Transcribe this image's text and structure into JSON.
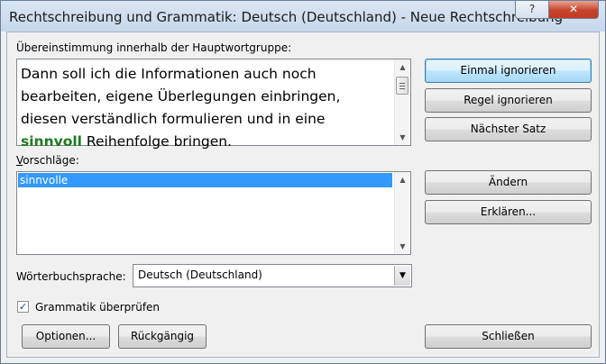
{
  "window": {
    "title": "Rechtschreibung und Grammatik: Deutsch (Deutschland) - Neue Rechtschreibung",
    "help_glyph": "?",
    "close_glyph": "✕"
  },
  "error_section": {
    "label": "Übereinstimmung innerhalb der Hauptwortgruppe:",
    "sentence_before": "Dann soll ich die Informationen auch noch bearbeiten, eigene Überlegungen einbringen, diesen verständlich formulieren und in eine ",
    "sentence_error": "sinnvoll",
    "sentence_after": " Reihenfolge bringen.",
    "error_color": "#1f7a1f"
  },
  "suggestions": {
    "label": "Vorschläge:",
    "items": [
      "sinnvolle"
    ],
    "selected_index": 0
  },
  "dictionary": {
    "label": "Wörterbuchsprache:",
    "value": "Deutsch (Deutschland)"
  },
  "grammar_check": {
    "label": "Grammatik überprüfen",
    "checked": true,
    "check_glyph": "✓"
  },
  "buttons": {
    "ignore_once": "Einmal ignorieren",
    "ignore_rule": "Regel ignorieren",
    "next_sentence": "Nächster Satz",
    "change": "Ändern",
    "explain": "Erklären...",
    "options": "Optionen...",
    "undo": "Rückgängig",
    "close": "Schließen"
  },
  "colors": {
    "selection": "#3399ff",
    "title_bar": "#d9e5f3",
    "close_button": "#c7432b"
  }
}
